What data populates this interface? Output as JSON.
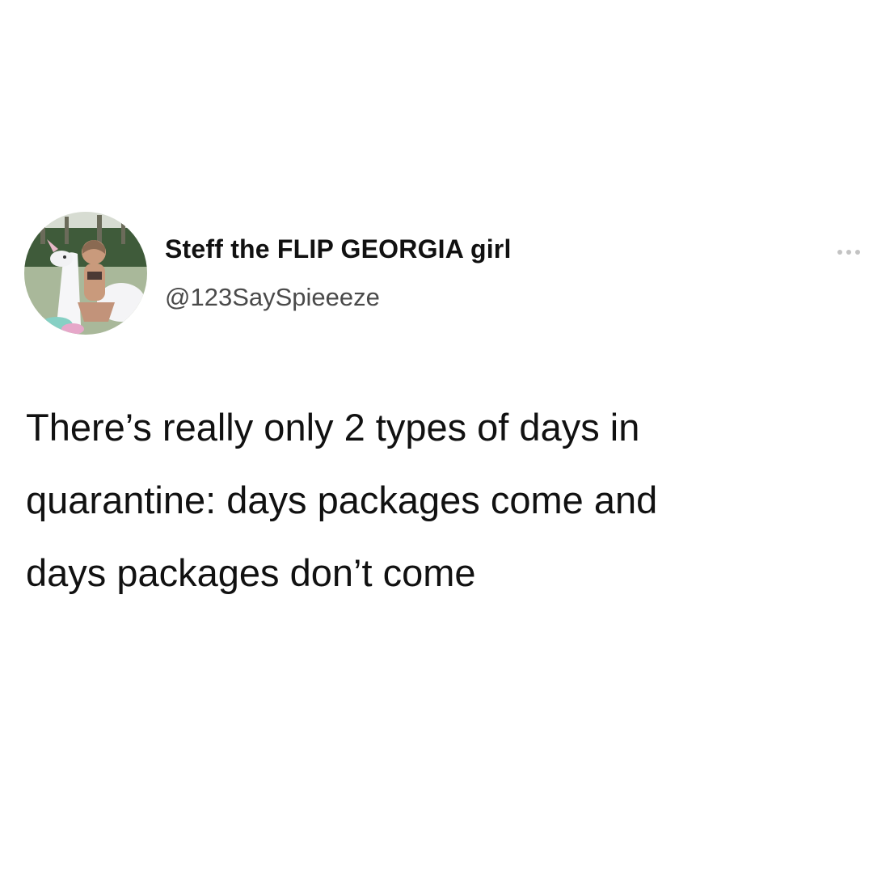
{
  "tweet": {
    "author": {
      "display_name": "Steff the FLIP GEORGIA girl",
      "handle": "@123SaySpieeeze",
      "avatar_icon": "profile-photo"
    },
    "more_icon": "more-horizontal-icon",
    "text_lines": [
      "There’s really only 2 types of days in",
      "quarantine: days packages come and",
      "days packages don’t come"
    ]
  }
}
